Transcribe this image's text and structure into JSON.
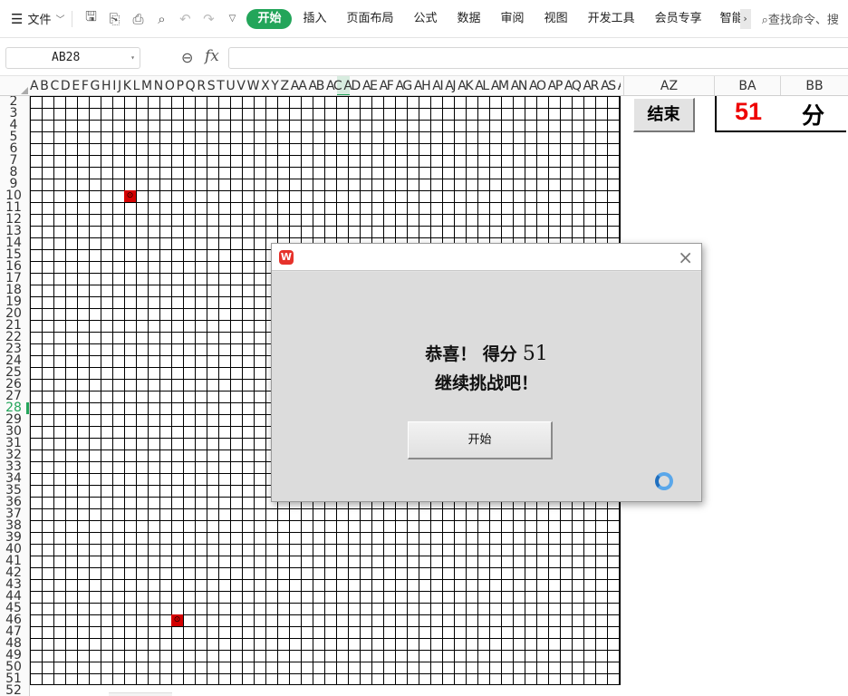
{
  "ribbon": {
    "menu_label": "文件",
    "tabs": [
      "开始",
      "插入",
      "页面布局",
      "公式",
      "数据",
      "审阅",
      "视图",
      "开发工具",
      "会员专享",
      "智能"
    ],
    "active_tab": "开始",
    "search_placeholder": "查找命令、搜"
  },
  "formula_bar": {
    "name_box": "AB28",
    "formula": ""
  },
  "columns": {
    "letters": "A B C D E F G H I J K L M N O P Q R S T U V W X Y Z AA AB AC AD AE AF AG AH AI AJ AK AL AM AN AO AP AQ AR AS AT AU AV AW AX AY",
    "az": "AZ",
    "ba": "BA",
    "bb": "BB"
  },
  "rows": [
    "2",
    "3",
    "4",
    "5",
    "6",
    "7",
    "8",
    "9",
    "10",
    "11",
    "12",
    "13",
    "14",
    "15",
    "16",
    "17",
    "18",
    "19",
    "20",
    "21",
    "22",
    "23",
    "24",
    "25",
    "26",
    "27",
    "28",
    "29",
    "30",
    "31",
    "32",
    "33",
    "34",
    "35",
    "36",
    "37",
    "38",
    "39",
    "40",
    "41",
    "42",
    "43",
    "44",
    "45",
    "46",
    "47",
    "48",
    "49",
    "50",
    "51",
    "52"
  ],
  "selected_row": "28",
  "grid_cells": [
    {
      "label": "⊙",
      "color": "#d40000"
    },
    {
      "label": "⊙",
      "color": "#d40000"
    }
  ],
  "game": {
    "end_button": "结束",
    "score": "51",
    "score_unit": "分"
  },
  "dialog": {
    "logo": "W",
    "line1": "恭喜！ 得分",
    "score": "51",
    "line2": "继续挑战吧！",
    "start_button": "开始"
  }
}
